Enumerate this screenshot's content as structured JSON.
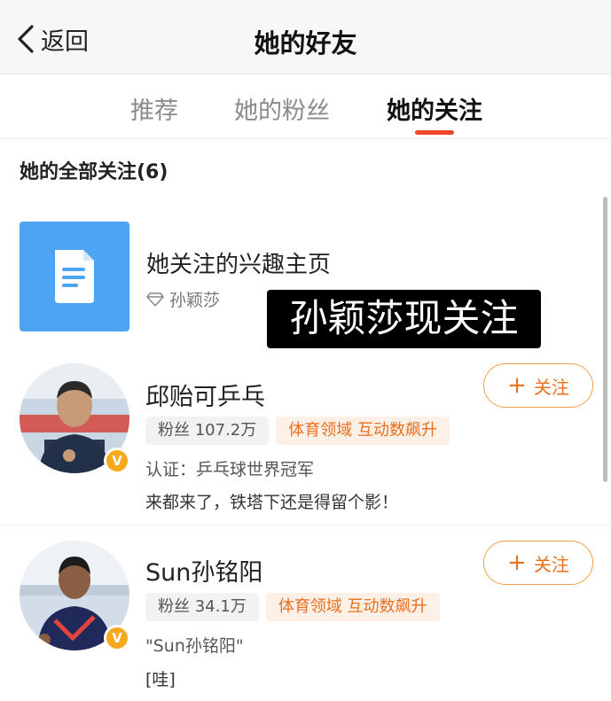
{
  "nav": {
    "back_label": "返回",
    "title": "她的好友"
  },
  "tabs": [
    {
      "label": "推荐"
    },
    {
      "label": "她的粉丝"
    },
    {
      "label": "她的关注"
    }
  ],
  "section_title": "她的全部关注(6)",
  "interest": {
    "title": "她关注的兴趣主页",
    "owner": "孙颖莎"
  },
  "caption": "孙颖莎现关注",
  "users": [
    {
      "name": "邱贻可乒乓",
      "fans": "粉丝 107.2万",
      "tag": "体育领域 互动数飙升",
      "verification": "认证：乒乓球世界冠军",
      "latest_post": "来都来了，铁塔下还是得留个影！",
      "badge": "V",
      "follow_label": "关注"
    },
    {
      "name": "Sun孙铭阳",
      "fans": "粉丝 34.1万",
      "tag": "体育领域 互动数飙升",
      "verification": "\"Sun孙铭阳\"",
      "latest_post": "[哇]",
      "badge": "V",
      "follow_label": "关注"
    }
  ],
  "colors": {
    "accent": "#f0462a",
    "follow": "#e8701f",
    "interest_bg": "#4da4f2",
    "badge": "#f6a91a"
  }
}
